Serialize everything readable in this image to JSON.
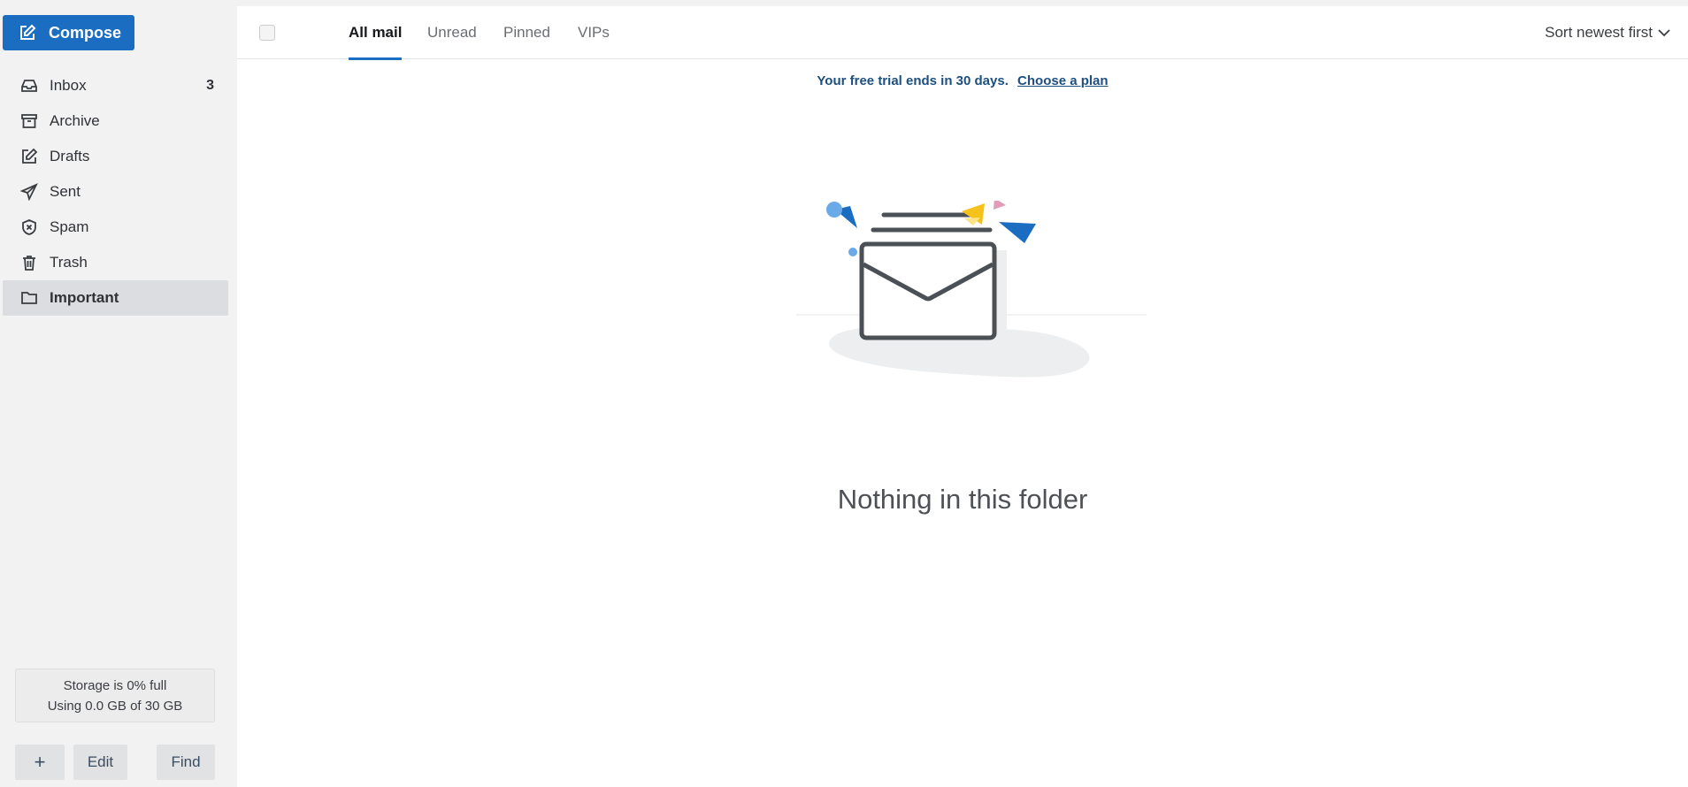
{
  "sidebar": {
    "compose_label": "Compose",
    "items": [
      {
        "label": "Inbox",
        "count": "3",
        "icon": "inbox-icon"
      },
      {
        "label": "Archive",
        "count": "",
        "icon": "archive-icon"
      },
      {
        "label": "Drafts",
        "count": "",
        "icon": "drafts-icon"
      },
      {
        "label": "Sent",
        "count": "",
        "icon": "sent-icon"
      },
      {
        "label": "Spam",
        "count": "",
        "icon": "spam-icon"
      },
      {
        "label": "Trash",
        "count": "",
        "icon": "trash-icon"
      },
      {
        "label": "Important",
        "count": "",
        "icon": "folder-icon"
      }
    ],
    "storage": {
      "line1": "Storage is 0% full",
      "line2": "Using 0.0 GB of 30 GB"
    },
    "footer": {
      "add_label": "+",
      "edit_label": "Edit",
      "find_label": "Find"
    }
  },
  "toolbar": {
    "tabs": [
      "All mail",
      "Unread",
      "Pinned",
      "VIPs"
    ],
    "active_tab": "All mail",
    "sort_label": "Sort newest first"
  },
  "banner": {
    "message": "Your free trial ends in 30 days.",
    "link": "Choose a plan"
  },
  "empty_state": {
    "title": "Nothing in this folder"
  },
  "colors": {
    "accent": "#1a6dc0",
    "banner_text": "#1d4f80",
    "confetti_blue": "#1a6dc0",
    "confetti_light_blue": "#6aaae8",
    "confetti_yellow": "#f5c21b",
    "confetti_pink": "#e29bb8"
  }
}
